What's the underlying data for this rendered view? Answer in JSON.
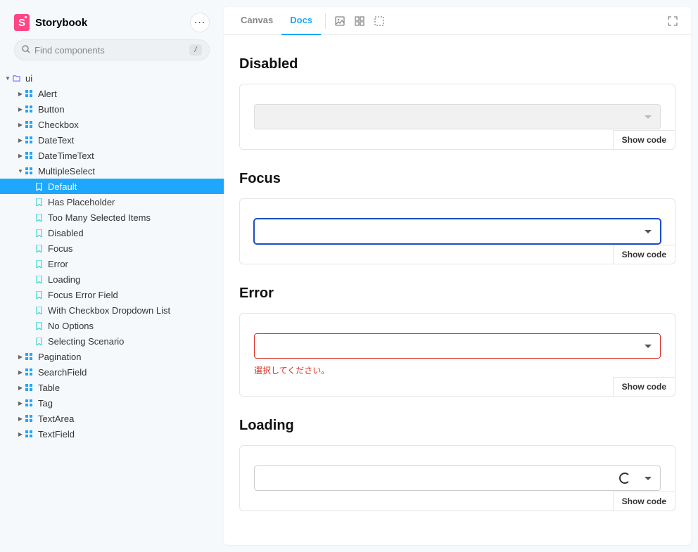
{
  "app": {
    "name": "Storybook",
    "logo_letter": "S"
  },
  "search": {
    "placeholder": "Find components",
    "shortcut": "/"
  },
  "tree": {
    "root": "ui",
    "components": [
      "Alert",
      "Button",
      "Checkbox",
      "DateText",
      "DateTimeText"
    ],
    "expanded_component": "MultipleSelect",
    "stories": [
      "Default",
      "Has Placeholder",
      "Too Many Selected Items",
      "Disabled",
      "Focus",
      "Error",
      "Loading",
      "Focus Error Field",
      "With Checkbox Dropdown List",
      "No Options",
      "Selecting Scenario"
    ],
    "active_story": "Default",
    "components_after": [
      "Pagination",
      "SearchField",
      "Table",
      "Tag",
      "TextArea",
      "TextField"
    ]
  },
  "toolbar": {
    "tabs": [
      "Canvas",
      "Docs"
    ],
    "active_tab": "Docs"
  },
  "sections": {
    "disabled": {
      "title": "Disabled",
      "show_code": "Show code"
    },
    "focus": {
      "title": "Focus",
      "show_code": "Show code"
    },
    "error": {
      "title": "Error",
      "message": "選択してください。",
      "show_code": "Show code"
    },
    "loading": {
      "title": "Loading",
      "show_code": "Show code"
    }
  }
}
